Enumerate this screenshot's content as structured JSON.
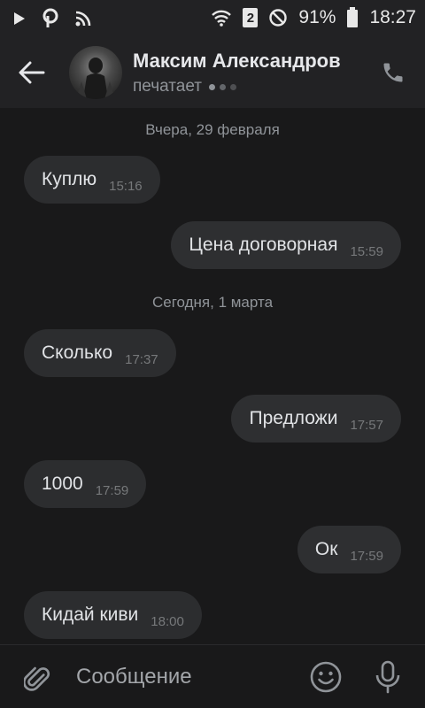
{
  "status_bar": {
    "battery": "91%",
    "time": "18:27",
    "sim": "2",
    "icons": [
      "play-icon",
      "pinterest-icon",
      "cast-icon",
      "wifi-icon",
      "sim-icon",
      "do-not-disturb-icon",
      "battery-icon"
    ]
  },
  "header": {
    "contact_name": "Максим Александров",
    "status": "печатает",
    "icons": [
      "back-arrow-icon",
      "avatar",
      "phone-icon"
    ]
  },
  "messages": {
    "dates": [
      "Вчера, 29 февраля",
      "Сегодня, 1 марта"
    ],
    "items": [
      {
        "direction": "in",
        "text": "Куплю",
        "time": "15:16"
      },
      {
        "direction": "out",
        "text": "Цена договорная",
        "time": "15:59"
      },
      {
        "direction": "in",
        "text": "Сколько",
        "time": "17:37"
      },
      {
        "direction": "out",
        "text": "Предложи",
        "time": "17:57"
      },
      {
        "direction": "in",
        "text": "1000",
        "time": "17:59"
      },
      {
        "direction": "out",
        "text": "Ок",
        "time": "17:59"
      },
      {
        "direction": "in",
        "text": "Кидай киви",
        "time": "18:00"
      }
    ]
  },
  "composer": {
    "placeholder": "Сообщение",
    "value": "",
    "icons": [
      "paperclip-icon",
      "emoji-icon",
      "microphone-icon"
    ]
  },
  "colors": {
    "background": "#19191a",
    "bar": "#222224",
    "bubble": "#2c2d2f",
    "text": "#e1e3e6",
    "secondary": "#909499"
  }
}
